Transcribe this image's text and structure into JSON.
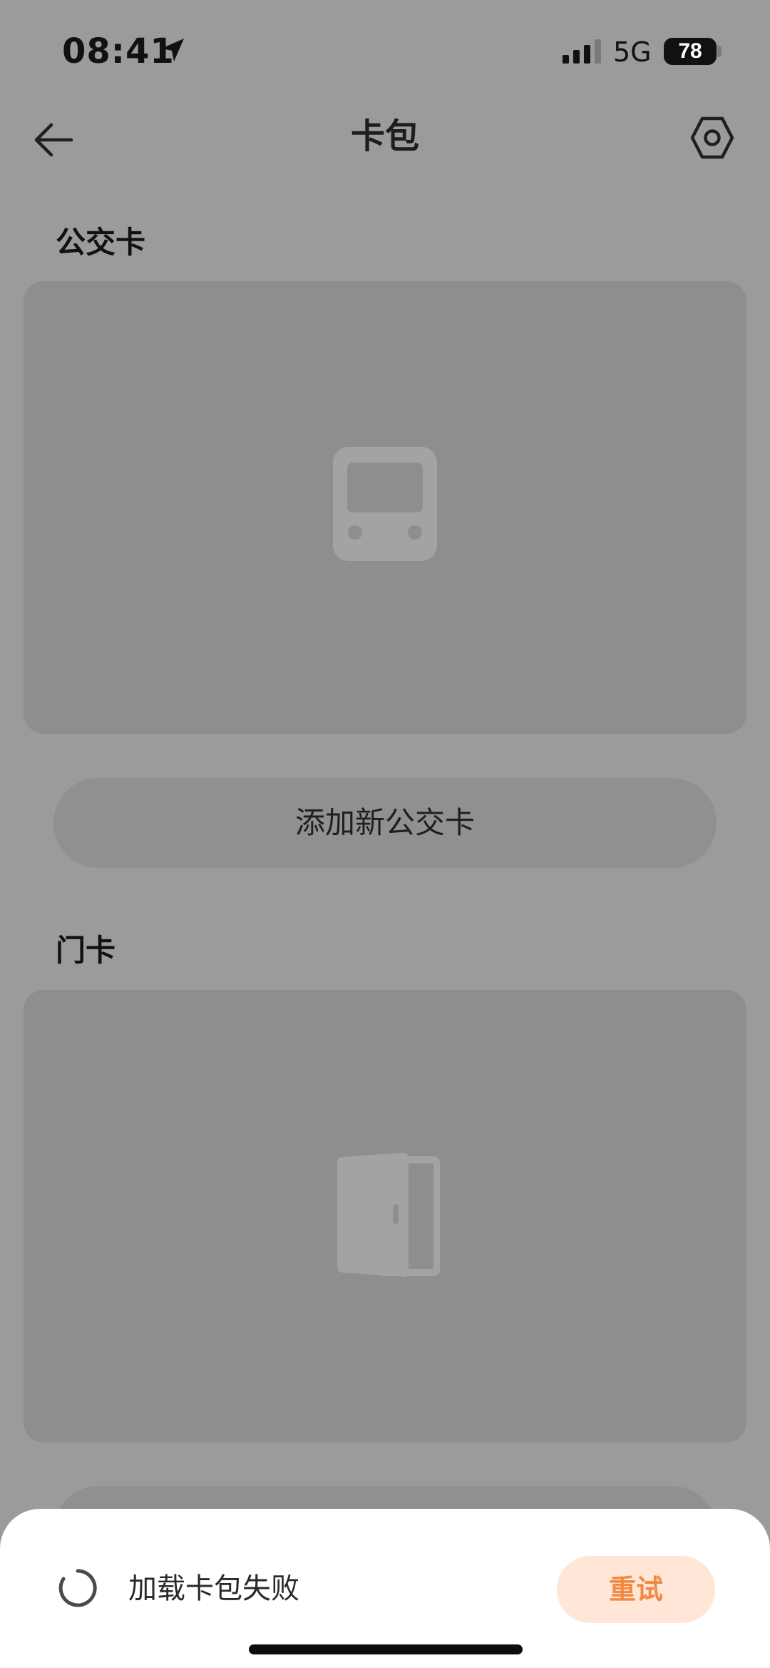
{
  "status_bar": {
    "time": "08:41",
    "location_icon": "location-arrow-icon",
    "signal_icon": "cellular-signal-icon",
    "network": "5G",
    "battery_level": "78"
  },
  "header": {
    "title": "卡包",
    "back_icon": "arrow-left-icon",
    "settings_icon": "hexagon-gear-icon"
  },
  "sections": [
    {
      "title": "公交卡",
      "card_icon": "bus-icon",
      "add_button_label": "添加新公交卡"
    },
    {
      "title": "门卡",
      "card_icon": "door-icon"
    }
  ],
  "bottom_sheet": {
    "message": "加载卡包失败",
    "spinner_icon": "loading-spinner-icon",
    "retry_label": "重试"
  },
  "colors": {
    "overlay_background": "#9b9b9b",
    "card_panel": "#8e8e8e",
    "retry_text": "#f08a43",
    "retry_background": "#ffe6d6",
    "sheet_background": "#ffffff"
  }
}
